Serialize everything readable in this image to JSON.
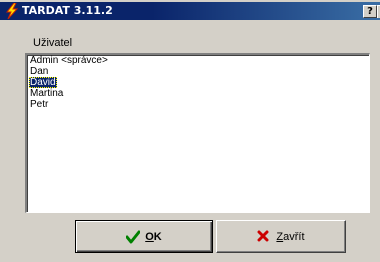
{
  "window": {
    "title": "TARDAT 3.11.2",
    "help_label": "?",
    "title_icon": "lightning-icon"
  },
  "list": {
    "label": "Uživatel",
    "items": [
      {
        "label": "Admin <správce>",
        "selected": false
      },
      {
        "label": "Dan",
        "selected": false
      },
      {
        "label": "David",
        "selected": true
      },
      {
        "label": "Martina",
        "selected": false
      },
      {
        "label": "Petr",
        "selected": false
      }
    ]
  },
  "buttons": {
    "ok": {
      "label_mnemonic": "O",
      "label_rest": "K",
      "icon": "checkmark-icon",
      "icon_color": "#008000"
    },
    "close": {
      "label_mnemonic": "Z",
      "label_rest": "avřít",
      "icon": "x-mark-icon",
      "icon_color": "#cc0000"
    }
  },
  "colors": {
    "titlebar": "#0a246a",
    "selection": "#0a246a",
    "face": "#d4d0c8"
  }
}
